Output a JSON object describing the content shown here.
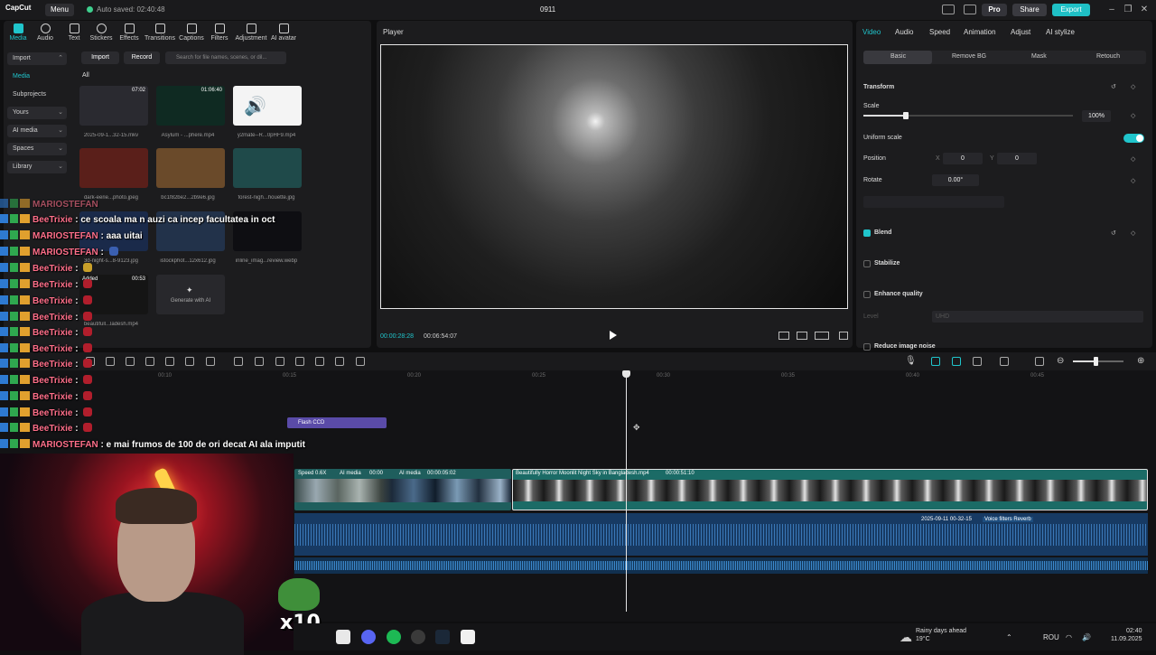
{
  "app": {
    "logo": "CapCut",
    "menu_label": "Menu",
    "autosave": "Auto saved: 02:40:48",
    "project_name": "0911",
    "pro_label": "Pro",
    "share_label": "Share",
    "export_label": "Export"
  },
  "toolbar": [
    "Media",
    "Audio",
    "Text",
    "Stickers",
    "Effects",
    "Transitions",
    "Captions",
    "Filters",
    "Adjustment",
    "AI avatar"
  ],
  "sidebar": [
    "Import",
    "Media",
    "Subprojects",
    "Yours",
    "AI media",
    "Spaces",
    "Library"
  ],
  "media": {
    "import_label": "Import",
    "record_label": "Record",
    "search_placeholder": "Search for file names, scenes, or dil...",
    "all_label": "All",
    "items": [
      {
        "name": "2025-09-1...32-15.mkv",
        "duration": "07:02",
        "color": "#2a2a30"
      },
      {
        "name": "Asylum - ...phere.mp4",
        "duration": "01:06:40",
        "color": "#0f2a22"
      },
      {
        "name": "y2mate--R...0pHF9.mp4",
        "duration": "",
        "color": "#f4f4f4"
      },
      {
        "name": "dark-eerie...photo.jpeg",
        "duration": "",
        "color": "#5a1f1a"
      },
      {
        "name": "bc1f82be2...2b9e6.jpg",
        "duration": "",
        "color": "#6a4a2a"
      },
      {
        "name": "forest-nigh...houette.jpg",
        "duration": "",
        "color": "#1f4a4a"
      },
      {
        "name": "3d-night-s...8-9123.jpg",
        "duration": "",
        "color": "#1a2a4a"
      },
      {
        "name": "istockphot...12x612.jpg",
        "duration": "",
        "color": "#22324a"
      },
      {
        "name": "inline_imag...review.webp",
        "duration": "",
        "color": "#0e0e12"
      },
      {
        "name": "beautifull...ladesh.mp4",
        "duration": "00:53",
        "added": "Added",
        "color": "#151515"
      }
    ],
    "generate_label": "Generate with AI"
  },
  "player": {
    "title": "Player",
    "current_time": "00:00:28:28",
    "total_time": "00:06:54:07"
  },
  "inspector": {
    "tabs": [
      "Video",
      "Audio",
      "Speed",
      "Animation",
      "Adjust",
      "AI stylize"
    ],
    "subtabs": [
      "Basic",
      "Remove BG",
      "Mask",
      "Retouch"
    ],
    "transform_label": "Transform",
    "scale_label": "Scale",
    "scale_value": "100%",
    "scale_level": 0.2,
    "uniform_scale_label": "Uniform scale",
    "position_label": "Position",
    "pos_x_label": "X",
    "pos_x": "0",
    "pos_y_label": "Y",
    "pos_y": "0",
    "rotate_label": "Rotate",
    "rotate_value": "0.00°",
    "blend_label": "Blend",
    "stabilize_label": "Stabilize",
    "enhance_label": "Enhance quality",
    "level_label": "Level",
    "level_value": "UHD",
    "noise_label": "Reduce image noise"
  },
  "timeline": {
    "ticks": [
      "00:10",
      "00:15",
      "00:20",
      "00:25",
      "00:30",
      "00:35",
      "00:40",
      "00:45"
    ],
    "flash_label": "Flash CCD",
    "clip1_speed": "Speed 0.6X",
    "clip1_ai_a": "AI media",
    "clip1_time_a": "00:00",
    "clip1_ai_b": "AI media",
    "clip1_time_b": "00:00:05:02",
    "clip2_name": "Beautifully Horror Moonlit Night Sky in Bangladesh.mp4",
    "clip2_duration": "00:00:51:10",
    "audio_name": "2025-09-11 00-32-15",
    "audio_filter": "Voice filters Reverb"
  },
  "chat": [
    {
      "user": "MARIOSTEFAN",
      "msg": "",
      "color": "#ff6f8a"
    },
    {
      "user": "BeeTrixie",
      "msg": "ce scoala ma n auzi ca incep facultatea in oct",
      "color": "#ff6f8a"
    },
    {
      "user": "MARIOSTEFAN",
      "msg": "aaa uitai",
      "color": "#ff6f8a"
    },
    {
      "user": "MARIOSTEFAN",
      "msg": "",
      "color": "#ff6f8a"
    },
    {
      "user": "BeeTrixie",
      "msg": "",
      "color": "#ff6f8a"
    },
    {
      "user": "BeeTrixie",
      "msg": "",
      "color": "#ff6f8a"
    },
    {
      "user": "BeeTrixie",
      "msg": "",
      "color": "#ff6f8a"
    },
    {
      "user": "BeeTrixie",
      "msg": "",
      "color": "#ff6f8a"
    },
    {
      "user": "BeeTrixie",
      "msg": "",
      "color": "#ff6f8a"
    },
    {
      "user": "BeeTrixie",
      "msg": "",
      "color": "#ff6f8a"
    },
    {
      "user": "BeeTrixie",
      "msg": "",
      "color": "#ff6f8a"
    },
    {
      "user": "BeeTrixie",
      "msg": "",
      "color": "#ff6f8a"
    },
    {
      "user": "BeeTrixie",
      "msg": "",
      "color": "#ff6f8a"
    },
    {
      "user": "BeeTrixie",
      "msg": "",
      "color": "#ff6f8a"
    },
    {
      "user": "MARIOSTEFAN",
      "msg": "e mai frumos de 100 de ori decat AI ala imputit",
      "color": "#ff6f8a"
    }
  ],
  "overlay": {
    "x10": "x10"
  },
  "taskbar": {
    "weather_line1": "Rainy days ahead",
    "weather_line2": "19°C",
    "lang": "ROU",
    "time": "02:40",
    "date": "11.09.2025"
  }
}
